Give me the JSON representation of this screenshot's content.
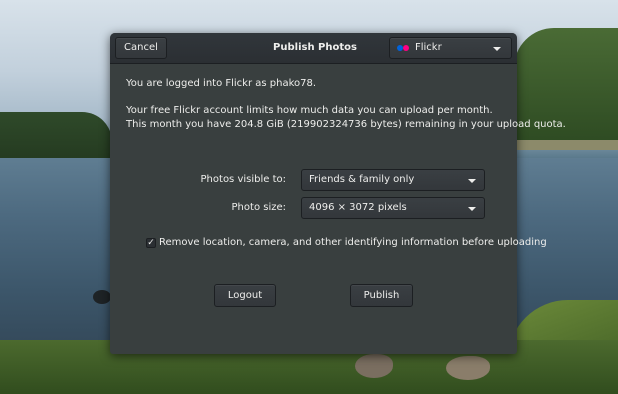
{
  "header": {
    "cancel_label": "Cancel",
    "title": "Publish Photos",
    "service": {
      "label": "Flickr",
      "icon": "flickr-logo-icon",
      "colors": {
        "blue": "#0063dc",
        "pink": "#ff0084"
      }
    }
  },
  "account": {
    "login_text": "You are logged into Flickr as phako78.",
    "limit_text": "Your free Flickr account limits how much data you can upload per month.",
    "quota_text": "This month you have 204.8 GiB (219902324736 bytes) remaining in your upload quota."
  },
  "settings": {
    "visibility_label": "Photos visible to:",
    "visibility_value": "Friends & family only",
    "size_label": "Photo size:",
    "size_value": "4096 × 3072 pixels",
    "strip_metadata_label": "Remove location, camera, and other identifying information before uploading",
    "strip_metadata_checked": true
  },
  "actions": {
    "logout_label": "Logout",
    "publish_label": "Publish"
  }
}
